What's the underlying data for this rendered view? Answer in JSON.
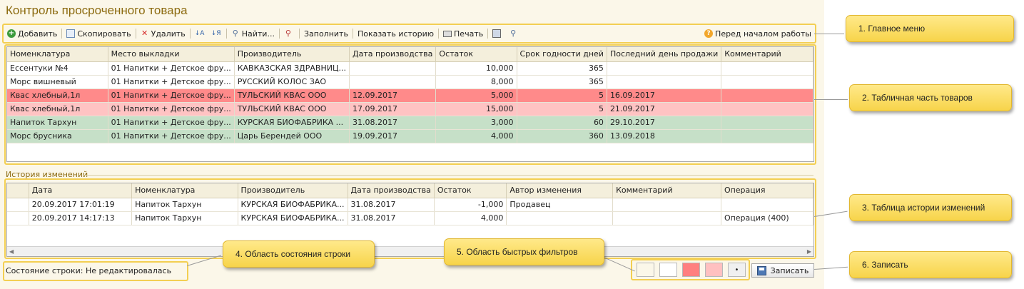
{
  "app": {
    "title": "Контроль просроченного товара"
  },
  "toolbar": {
    "add": "Добавить",
    "copy": "Скопировать",
    "delete": "Удалить",
    "find": "Найти...",
    "fill": "Заполнить",
    "show_history": "Показать историю",
    "print": "Печать",
    "help": "Перед началом работы"
  },
  "goods": {
    "columns": [
      "Номенклатура",
      "Место выкладки",
      "Производитель",
      "Дата производства",
      "Остаток",
      "Срок годности дней",
      "Последний день продажи",
      "Комментарий"
    ],
    "rows": [
      {
        "style": "white",
        "cells": [
          "Ессентуки №4",
          "01 Напитки + Детское фру...",
          "КАВКАЗСКАЯ ЗДРАВНИЦ...",
          "",
          "10,000",
          "365",
          "",
          ""
        ]
      },
      {
        "style": "white",
        "cells": [
          "Морс вишневый",
          "01 Напитки + Детское фру...",
          "РУССКИЙ КОЛОС ЗАО",
          "",
          "8,000",
          "365",
          "",
          ""
        ]
      },
      {
        "style": "red",
        "cells": [
          "Квас хлебный,1л",
          "01 Напитки + Детское фру...",
          "ТУЛЬСКИЙ КВАС ООО",
          "12.09.2017",
          "5,000",
          "5",
          "16.09.2017",
          ""
        ]
      },
      {
        "style": "pink",
        "cells": [
          "Квас хлебный,1л",
          "01 Напитки + Детское фру...",
          "ТУЛЬСКИЙ КВАС ООО",
          "17.09.2017",
          "15,000",
          "5",
          "21.09.2017",
          ""
        ]
      },
      {
        "style": "green",
        "cells": [
          "Напиток Тархун",
          "01 Напитки + Детское фру...",
          "КУРСКАЯ БИОФАБРИКА ...",
          "31.08.2017",
          "3,000",
          "60",
          "29.10.2017",
          ""
        ]
      },
      {
        "style": "green",
        "cells": [
          "Морс брусника",
          "01 Напитки + Детское фру...",
          "Царь Берендей ООО",
          "19.09.2017",
          "4,000",
          "360",
          "13.09.2018",
          ""
        ]
      }
    ]
  },
  "history": {
    "label": "История изменений",
    "columns": [
      "",
      "Дата",
      "Номенклатура",
      "Производитель",
      "Дата производства",
      "Остаток",
      "Автор изменения",
      "Комментарий",
      "Операция"
    ],
    "rows": [
      {
        "cells": [
          "",
          "20.09.2017 17:01:19",
          "Напиток Тархун",
          "КУРСКАЯ БИОФАБРИКА...",
          "31.08.2017",
          "-1,000",
          "Продавец",
          "",
          ""
        ]
      },
      {
        "cells": [
          "",
          "20.09.2017 14:17:13",
          "Напиток Тархун",
          "КУРСКАЯ БИОФАБРИКА...",
          "31.08.2017",
          "4,000",
          "",
          "",
          "Операция (400)"
        ]
      }
    ]
  },
  "status": {
    "text": "Состояние строки: Не редактировалась"
  },
  "filters": {
    "colors": [
      "#fbf7e9",
      "#ffffff",
      "#ff7f7f",
      "#ffc0c0",
      "#f0f0f0"
    ],
    "last_glyph": "•"
  },
  "save": {
    "label": "Записать"
  },
  "callouts": {
    "c1": "1. Главное меню",
    "c2": "2. Табличная часть товаров",
    "c3": "3. Таблица истории изменений",
    "c4": "4. Область состояния строки",
    "c5": "5. Область быстрых фильтров",
    "c6": "6. Записать"
  }
}
